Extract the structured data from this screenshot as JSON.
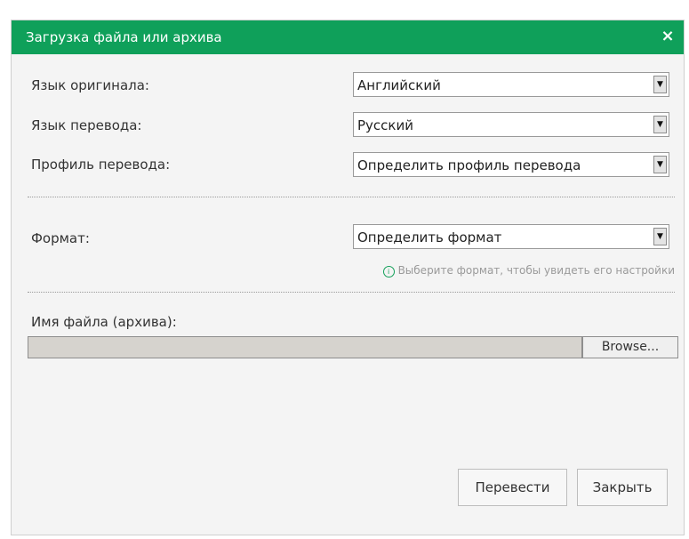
{
  "dialog": {
    "title": "Загрузка файла или архива",
    "close_symbol": "×",
    "accent_color": "#0fa05a"
  },
  "fields": {
    "source_language": {
      "label": "Язык оригинала:",
      "value": "Английский"
    },
    "target_language": {
      "label": "Язык перевода:",
      "value": "Русский"
    },
    "profile": {
      "label": "Профиль перевода:",
      "value": "Определить профиль перевода"
    },
    "format": {
      "label": "Формат:",
      "value": "Определить формат"
    }
  },
  "hint": {
    "icon": "info-icon",
    "icon_glyph": "i",
    "text": "Выберите формат, чтобы увидеть его настройки"
  },
  "file": {
    "label": "Имя файла (архива):",
    "value": "",
    "browse_label": "Browse..."
  },
  "buttons": {
    "translate_label": "Перевести",
    "close_label": "Закрыть"
  },
  "icons": {
    "dropdown": "chevron-down-icon",
    "dropdown_glyph": "▼"
  }
}
